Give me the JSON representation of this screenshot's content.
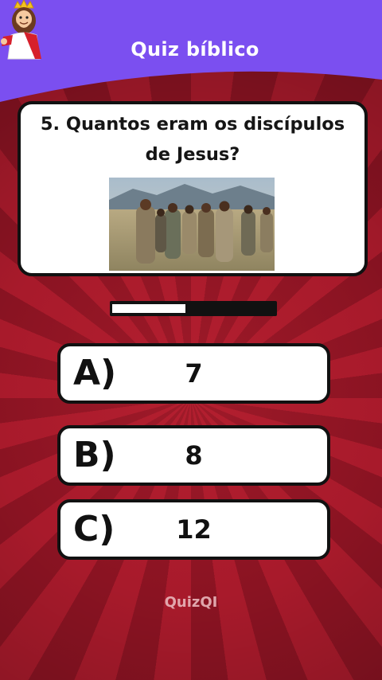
{
  "header": {
    "title": "Quiz bíblico",
    "mascot_icon": "jesus-crown-mascot-icon",
    "color": "#7b4ff0"
  },
  "question": {
    "text_line1": "5. Quantos eram os discípulos",
    "text_line2": "de Jesus?",
    "image_icon": "disciples-walking-photo"
  },
  "timer": {
    "remaining_fraction": 0.45
  },
  "answers": [
    {
      "letter": "A)",
      "value": "7"
    },
    {
      "letter": "B)",
      "value": "8"
    },
    {
      "letter": "C)",
      "value": "12"
    }
  ],
  "footer": {
    "brand": "QuizQI"
  },
  "colors": {
    "background": "#9c1727",
    "card": "#ffffff",
    "border": "#111111"
  }
}
